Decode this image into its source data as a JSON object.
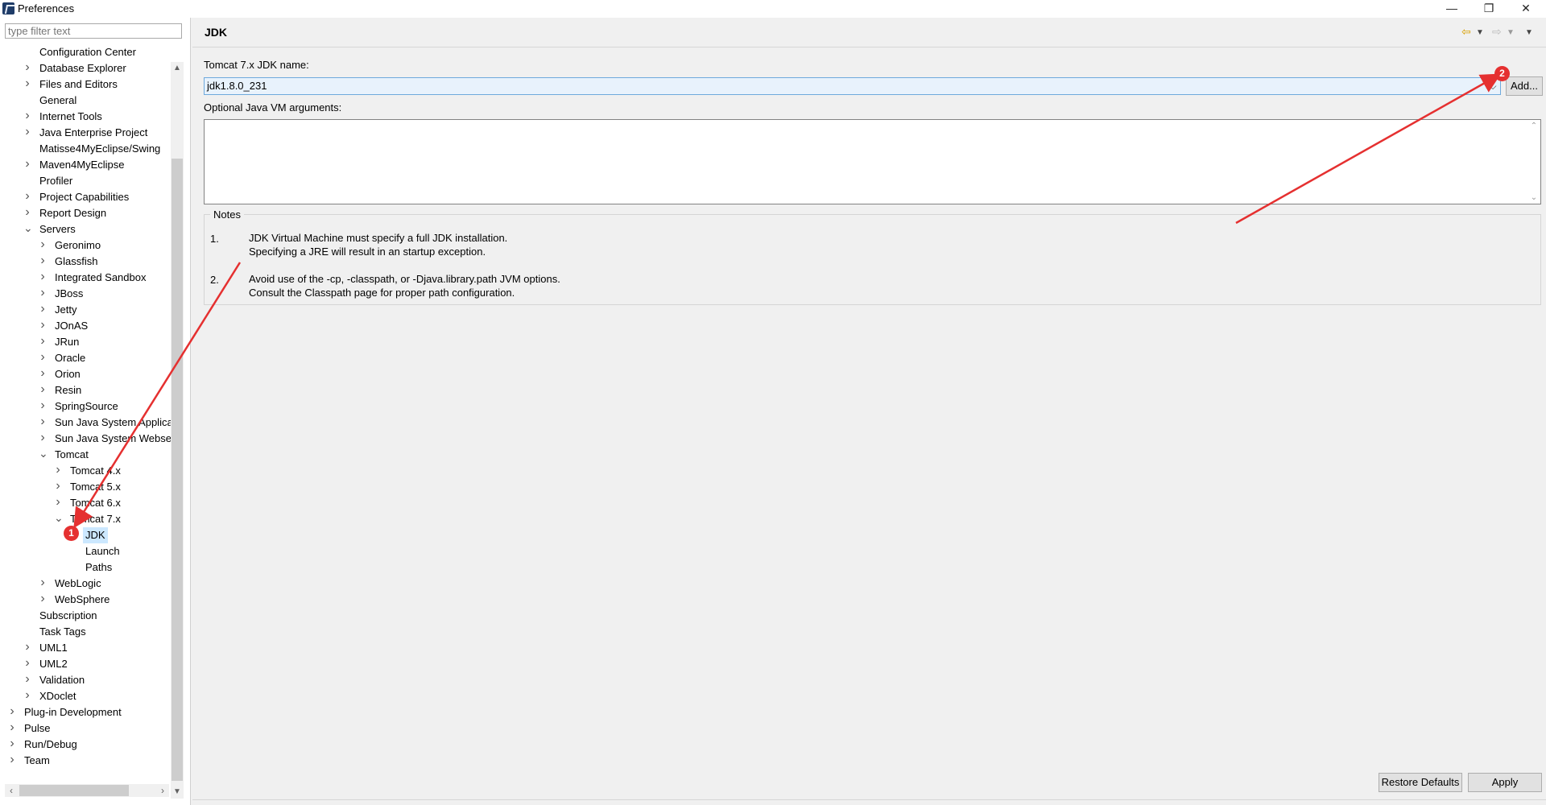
{
  "window": {
    "title": "Preferences",
    "minimize": "—",
    "restore": "❐",
    "close": "✕"
  },
  "filter": {
    "placeholder": "type filter text"
  },
  "tree": [
    {
      "label": "Configuration Center",
      "twisty": ""
    },
    {
      "label": "Database Explorer",
      "twisty": "c"
    },
    {
      "label": "Files and Editors",
      "twisty": "c"
    },
    {
      "label": "General",
      "twisty": ""
    },
    {
      "label": "Internet Tools",
      "twisty": "c"
    },
    {
      "label": "Java Enterprise Project",
      "twisty": "c"
    },
    {
      "label": "Matisse4MyEclipse/Swing",
      "twisty": ""
    },
    {
      "label": "Maven4MyEclipse",
      "twisty": "c"
    },
    {
      "label": "Profiler",
      "twisty": ""
    },
    {
      "label": "Project Capabilities",
      "twisty": "c"
    },
    {
      "label": "Report Design",
      "twisty": "c"
    },
    {
      "label": "Servers",
      "twisty": "o"
    },
    {
      "label": "Geronimo",
      "twisty": "c"
    },
    {
      "label": "Glassfish",
      "twisty": "c"
    },
    {
      "label": "Integrated Sandbox",
      "twisty": "c"
    },
    {
      "label": "JBoss",
      "twisty": "c"
    },
    {
      "label": "Jetty",
      "twisty": "c"
    },
    {
      "label": "JOnAS",
      "twisty": "c"
    },
    {
      "label": "JRun",
      "twisty": "c"
    },
    {
      "label": "Oracle",
      "twisty": "c"
    },
    {
      "label": "Orion",
      "twisty": "c"
    },
    {
      "label": "Resin",
      "twisty": "c"
    },
    {
      "label": "SpringSource",
      "twisty": "c"
    },
    {
      "label": "Sun Java System Applica",
      "twisty": "c"
    },
    {
      "label": "Sun Java System Webser",
      "twisty": "c"
    },
    {
      "label": "Tomcat",
      "twisty": "o"
    },
    {
      "label": "Tomcat  4.x",
      "twisty": "c"
    },
    {
      "label": "Tomcat  5.x",
      "twisty": "c"
    },
    {
      "label": "Tomcat  6.x",
      "twisty": "c"
    },
    {
      "label": "Tomcat  7.x",
      "twisty": "o"
    },
    {
      "label": "JDK",
      "twisty": "",
      "selected": true
    },
    {
      "label": "Launch",
      "twisty": ""
    },
    {
      "label": "Paths",
      "twisty": ""
    },
    {
      "label": "WebLogic",
      "twisty": "c"
    },
    {
      "label": "WebSphere",
      "twisty": "c"
    },
    {
      "label": "Subscription",
      "twisty": ""
    },
    {
      "label": "Task Tags",
      "twisty": ""
    },
    {
      "label": "UML1",
      "twisty": "c"
    },
    {
      "label": "UML2",
      "twisty": "c"
    },
    {
      "label": "Validation",
      "twisty": "c"
    },
    {
      "label": "XDoclet",
      "twisty": "c"
    },
    {
      "label": "Plug-in Development",
      "twisty": "c"
    },
    {
      "label": "Pulse",
      "twisty": "c"
    },
    {
      "label": "Run/Debug",
      "twisty": "c"
    },
    {
      "label": "Team",
      "twisty": "c"
    }
  ],
  "page": {
    "title": "JDK",
    "jdk_label": "Tomcat  7.x JDK name:",
    "jdk_value": "jdk1.8.0_231",
    "add_button": "Add...",
    "vm_args_label": "Optional Java VM arguments:",
    "vm_args_value": "",
    "notes_title": "Notes",
    "notes": [
      {
        "num": "1.",
        "lines": [
          "JDK Virtual Machine must specify a full JDK installation.",
          "Specifying a JRE will result in an startup exception."
        ]
      },
      {
        "num": "2.",
        "lines": [
          "Avoid use of the -cp, -classpath, or -Djava.library.path JVM options.",
          "Consult the Classpath page for proper path configuration."
        ]
      }
    ],
    "restore_defaults": "Restore Defaults",
    "apply": "Apply"
  },
  "annotations": {
    "badge1": "1",
    "badge2": "2",
    "color": "#e53030"
  },
  "colors": {
    "selection": "#cce8ff",
    "combo_border": "#6ea9dc"
  }
}
